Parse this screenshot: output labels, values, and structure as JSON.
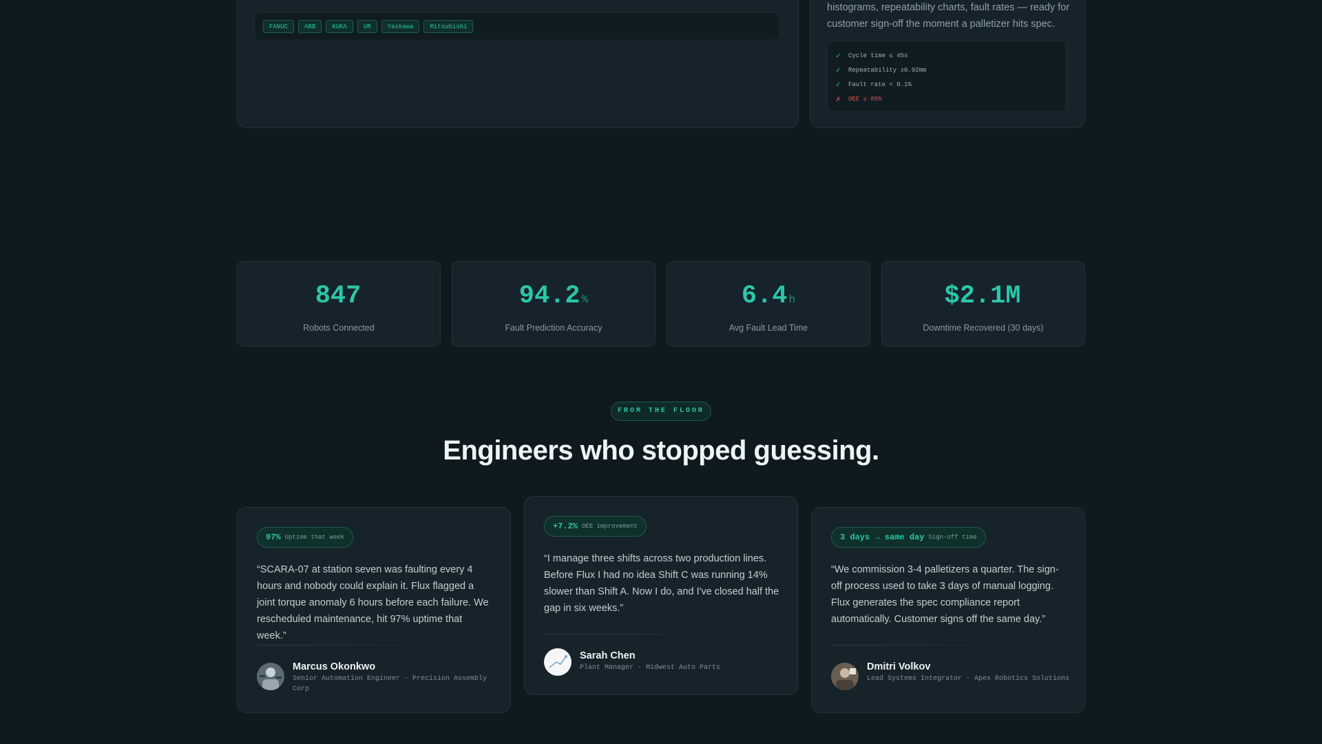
{
  "integrations": {
    "brands": [
      "FANUC",
      "ABB",
      "KUKA",
      "UR",
      "Yaskawa",
      "Mitsubishi"
    ]
  },
  "report": {
    "description": "histograms, repeatability charts, fault rates — ready for customer sign-off the moment a palletizer hits spec.",
    "checks": [
      {
        "label": "Cycle time ≤ 45s",
        "status": "pass",
        "icon": "check-icon"
      },
      {
        "label": "Repeatability ±0.02mm",
        "status": "pass",
        "icon": "check-icon"
      },
      {
        "label": "Fault rate < 0.1%",
        "status": "pass",
        "icon": "check-icon"
      },
      {
        "label": "OEE ≥ 85%",
        "status": "fail",
        "icon": "cross-icon"
      }
    ]
  },
  "stats": [
    {
      "value": "847",
      "unit": "",
      "label": "Robots Connected"
    },
    {
      "value": "94.2",
      "unit": "%",
      "label": "Fault Prediction Accuracy"
    },
    {
      "value": "6.4",
      "unit": "h",
      "label": "Avg Fault Lead Time"
    },
    {
      "value": "$2.1M",
      "unit": "",
      "label": "Downtime Recovered (30 days)"
    }
  ],
  "testimonials_section": {
    "eyebrow": "FROM THE FLOOR",
    "title": "Engineers who stopped guessing."
  },
  "testimonials": [
    {
      "metric_value": "97%",
      "metric_label": "Uptime that week",
      "quote": "“SCARA-07 at station seven was faulting every 4 hours and nobody could explain it. Flux flagged a joint torque anomaly 6 hours before each failure. We rescheduled maintenance, hit 97% uptime that week.”",
      "name": "Marcus Okonkwo",
      "role": "Senior Automation Engineer · Precision Assembly Corp"
    },
    {
      "metric_value": "+7.2%",
      "metric_label": "OEE improvement",
      "quote": "“I manage three shifts across two production lines. Before Flux I had no idea Shift C was running 14% slower than Shift A. Now I do, and I've closed half the gap in six weeks.”",
      "name": "Sarah Chen",
      "role": "Plant Manager · Midwest Auto Parts"
    },
    {
      "metric_value": "3 days → same day",
      "metric_label": "Sign-off time",
      "quote": "“We commission 3-4 palletizers a quarter. The sign-off process used to take 3 days of manual logging. Flux generates the spec compliance report automatically. Customer signs off the same day.”",
      "name": "Dmitri Volkov",
      "role": "Lead Systems Integrator · Apex Robotics Solutions"
    }
  ],
  "colors": {
    "background": "#0f1a1f",
    "card": "#16232a",
    "accent": "#2bc6a8",
    "fail": "#e0504a"
  }
}
